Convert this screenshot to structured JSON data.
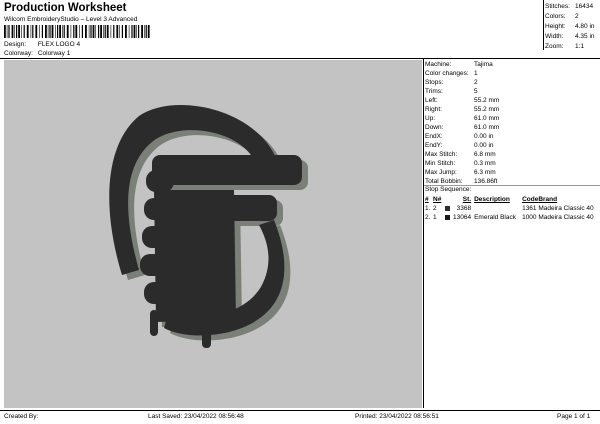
{
  "header": {
    "title": "Production Worksheet",
    "subtitle": "Wilcom EmbroideryStudio – Level 3 Advanced",
    "design_label": "Design:",
    "design_value": "FLEX LOGO 4",
    "colorway_label": "Colorway:",
    "colorway_value": "Colorway 1"
  },
  "summary": [
    {
      "label": "Stitches:",
      "value": "16434"
    },
    {
      "label": "Colors:",
      "value": "2"
    },
    {
      "label": "Height:",
      "value": "4.80 in"
    },
    {
      "label": "Width:",
      "value": "4.35 in"
    },
    {
      "label": "Zoom:",
      "value": "1:1"
    }
  ],
  "machine_info": [
    {
      "label": "Machine:",
      "value": "Tajima"
    },
    {
      "label": "Color changes:",
      "value": "1"
    },
    {
      "label": "Stops:",
      "value": "2"
    },
    {
      "label": "Trims:",
      "value": "5"
    },
    {
      "label": "Left:",
      "value": "55.2 mm"
    },
    {
      "label": "Right:",
      "value": "55.2 mm"
    },
    {
      "label": "Up:",
      "value": "61.0 mm"
    },
    {
      "label": "Down:",
      "value": "61.0 mm"
    },
    {
      "label": "EndX:",
      "value": "0.00 in"
    },
    {
      "label": "EndY:",
      "value": "0.00 in"
    },
    {
      "label": "Max Stitch:",
      "value": "6.8 mm"
    },
    {
      "label": "Min Stitch:",
      "value": "0.3 mm"
    },
    {
      "label": "Max Jump:",
      "value": "6.3 mm"
    },
    {
      "label": "Total Bobbin:",
      "value": "136.86ft"
    }
  ],
  "stop_sequence": {
    "title": "Stop Sequence:",
    "columns": [
      "#",
      "N#",
      "St.",
      "Description",
      "Code",
      "Brand"
    ],
    "rows": [
      {
        "idx": "1.",
        "n": "2",
        "color": "#2e2e2e",
        "st": "3368",
        "desc": "",
        "code": "1361",
        "brand": "Madeira Classic 40"
      },
      {
        "idx": "2.",
        "n": "1",
        "color": "#1a1a1a",
        "st": "13064",
        "desc": "Emerald Black",
        "code": "1000",
        "brand": "Madeira Classic 40"
      }
    ]
  },
  "footer": {
    "created_by": "Created By:",
    "last_saved": "Last Saved: 23/04/2022 08:56:48",
    "printed": "Printed: 23/04/2022 08:56:51",
    "page": "Page 1 of 1"
  },
  "colors": {
    "preview_bg": "#c3c3c3",
    "thread_dark": "#2b2b2b",
    "thread_shadow": "#7a7f78"
  }
}
